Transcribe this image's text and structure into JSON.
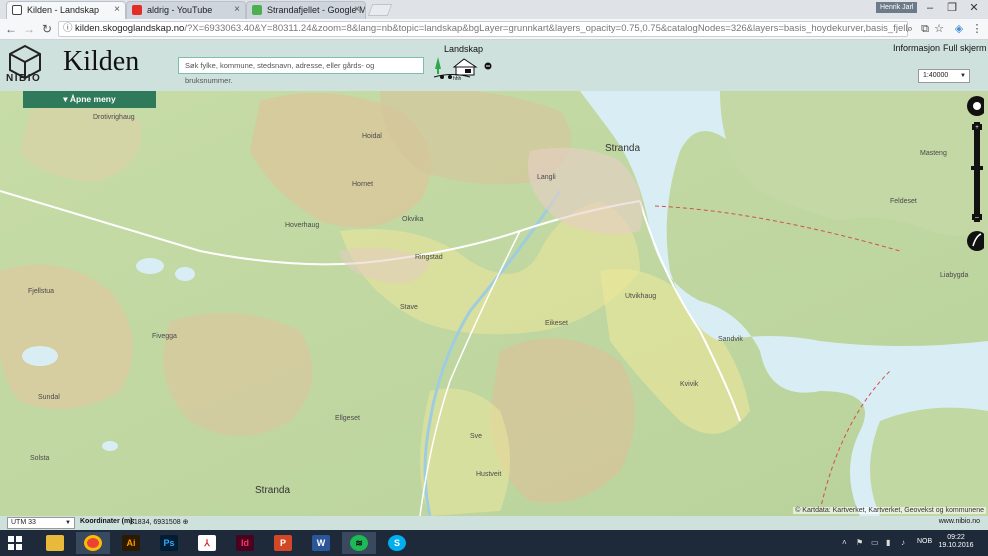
{
  "browser": {
    "tabs": [
      {
        "label": "Kilden - Landskap",
        "active": true
      },
      {
        "label": "aldrig - YouTube",
        "active": false
      },
      {
        "label": "Strandafjellet - Google M",
        "active": false
      }
    ],
    "user": "Henrik Jarl",
    "url_host": "kilden.skogoglandskap.no",
    "url_rest": "/?X=6933063.40&Y=80311.24&zoom=8&lang=nb&topic=landskap&bgLayer=grunnkart&layers_opacity=0.75,0.75&catalogNodes=326&layers=basis_hoydekurver,basis_fjellskygge"
  },
  "app": {
    "logo_text": "NIBIO",
    "title": "Kilden",
    "search_placeholder": "Søk fylke, kommune, stedsnavn, adresse, eller gårds- og bruksnummer.",
    "topic_label": "Landskap",
    "info_label": "Informasjon",
    "fullscreen_label": "Full skjerm",
    "scale_value": "1:40000",
    "menu_label": "Åpne meny"
  },
  "map": {
    "labels": {
      "stranda_north": "Stranda",
      "stranda_south": "Stranda",
      "liabygda": "Liabygda",
      "sandvik": "Sandvik",
      "drotivrighaug": "Drotivrighaug",
      "masteng": "Masteng",
      "feldeset": "Feldeset",
      "hoidal": "Hoidal",
      "hornet": "Hornet",
      "langli": "Langli",
      "ringstad": "Ringstad",
      "utvikhaug": "Utvikhaug",
      "eikeset": "Eikeset",
      "fivegga": "Fivegga",
      "kvivik": "Kvivik",
      "hhhr": "Hoverhaug",
      "stave": "Stave",
      "ellgeset": "Ellgeset",
      "suldal": "Sundal",
      "fjelltun": "Fjellstua",
      "sve": "Sve",
      "horsheim": "Hustveit",
      "okvik": "Okvika",
      "solsta": "Solsta"
    },
    "attribution": "© Kartdata: Kartverket, Kartverket, Geovekst og kommunene"
  },
  "footer": {
    "projection": "UTM 33",
    "coord_label": "Koordinater (m):",
    "coord_value": "81834, 6931508",
    "site": "www.nibio.no"
  },
  "taskbar": {
    "lang": "NOB",
    "time": "09:22",
    "date": "19.10.2016"
  },
  "colors": {
    "header_bg": "#cfe1dd",
    "menu_btn": "#2e7a5a",
    "water": "#d9eef4",
    "land": "#c9dcae"
  }
}
